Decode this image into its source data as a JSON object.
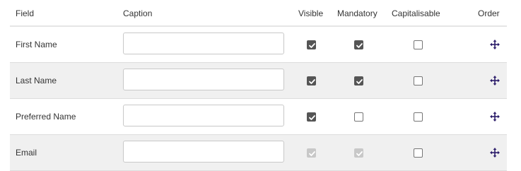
{
  "headers": {
    "field": "Field",
    "caption": "Caption",
    "visible": "Visible",
    "mandatory": "Mandatory",
    "capitalisable": "Capitalisable",
    "order": "Order"
  },
  "rows": [
    {
      "field": "First Name",
      "caption": "",
      "visible": {
        "checked": true,
        "disabled": false
      },
      "mandatory": {
        "checked": true,
        "disabled": false
      },
      "capitalisable": {
        "checked": false,
        "disabled": false
      },
      "order_icon": "move-icon"
    },
    {
      "field": "Last Name",
      "caption": "",
      "visible": {
        "checked": true,
        "disabled": false
      },
      "mandatory": {
        "checked": true,
        "disabled": false
      },
      "capitalisable": {
        "checked": false,
        "disabled": false
      },
      "order_icon": "move-icon"
    },
    {
      "field": "Preferred Name",
      "caption": "",
      "visible": {
        "checked": true,
        "disabled": false
      },
      "mandatory": {
        "checked": false,
        "disabled": false
      },
      "capitalisable": {
        "checked": false,
        "disabled": false
      },
      "order_icon": "move-icon"
    },
    {
      "field": "Email",
      "caption": "",
      "visible": {
        "checked": true,
        "disabled": true
      },
      "mandatory": {
        "checked": true,
        "disabled": true
      },
      "capitalisable": {
        "checked": false,
        "disabled": false
      },
      "order_icon": "move-icon"
    }
  ],
  "colors": {
    "row_alt_bg": "#f0f0f0",
    "checkbox_checked": "#555555",
    "checkbox_disabled_checked": "#c8c8c8",
    "move_icon": "#2d1e6b"
  }
}
